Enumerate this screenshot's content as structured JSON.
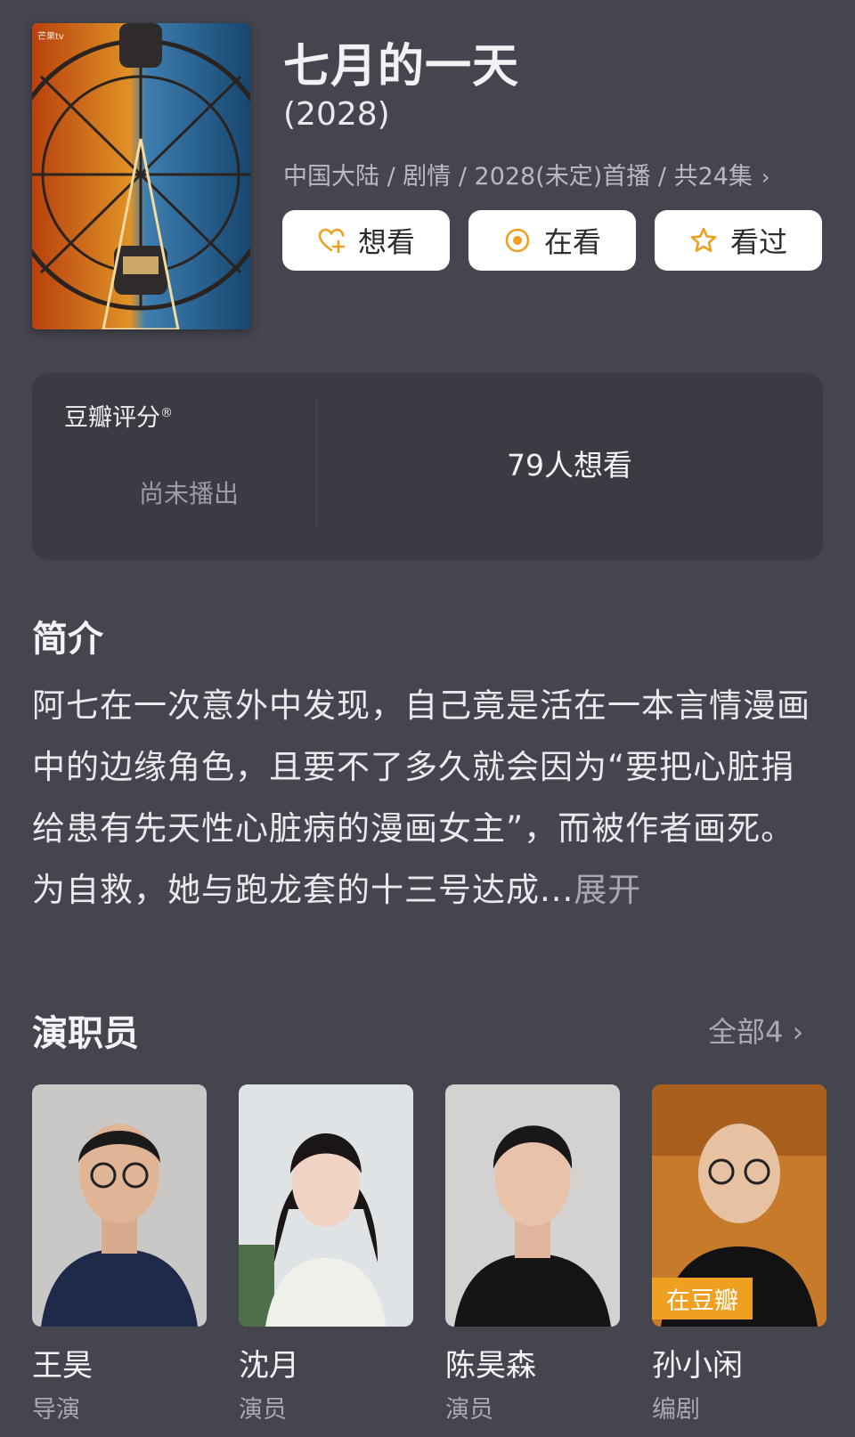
{
  "show": {
    "title": "七月的一天",
    "year": "(2028)",
    "meta": "中国大陆 / 剧情 / 2028(未定)首播 / 共24集",
    "meta_chevron": "›",
    "poster_logo": "芒果tv"
  },
  "actions": {
    "want": {
      "label": "想看",
      "icon": "heart-plus-icon"
    },
    "watching": {
      "label": "在看",
      "icon": "target-icon"
    },
    "watched": {
      "label": "看过",
      "icon": "star-icon"
    },
    "icon_color": "#f0a020"
  },
  "rating": {
    "label": "豆瓣评分",
    "mark": "®",
    "status": "尚未播出",
    "wish_count": "79人想看"
  },
  "intro": {
    "heading": "简介",
    "text": "阿七在一次意外中发现，自己竟是活在一本言情漫画中的边缘角色，且要不了多久就会因为“要把心脏捐给患有先天性心脏病的漫画女主”，而被作者画死。为自救，她与跑龙套的十三号达成...",
    "expand": "展开"
  },
  "cast": {
    "heading": "演职员",
    "all_label": "全部4",
    "all_chevron": "›",
    "members": [
      {
        "name": "王昊",
        "role": "导演"
      },
      {
        "name": "沈月",
        "role": "演员"
      },
      {
        "name": "陈昊森",
        "role": "演员"
      },
      {
        "name": "孙小闲",
        "role": "编剧",
        "badge": "在豆瓣"
      }
    ]
  },
  "colors": {
    "background": "#45454f",
    "card": "#3b3b44",
    "accent": "#f0a020"
  }
}
